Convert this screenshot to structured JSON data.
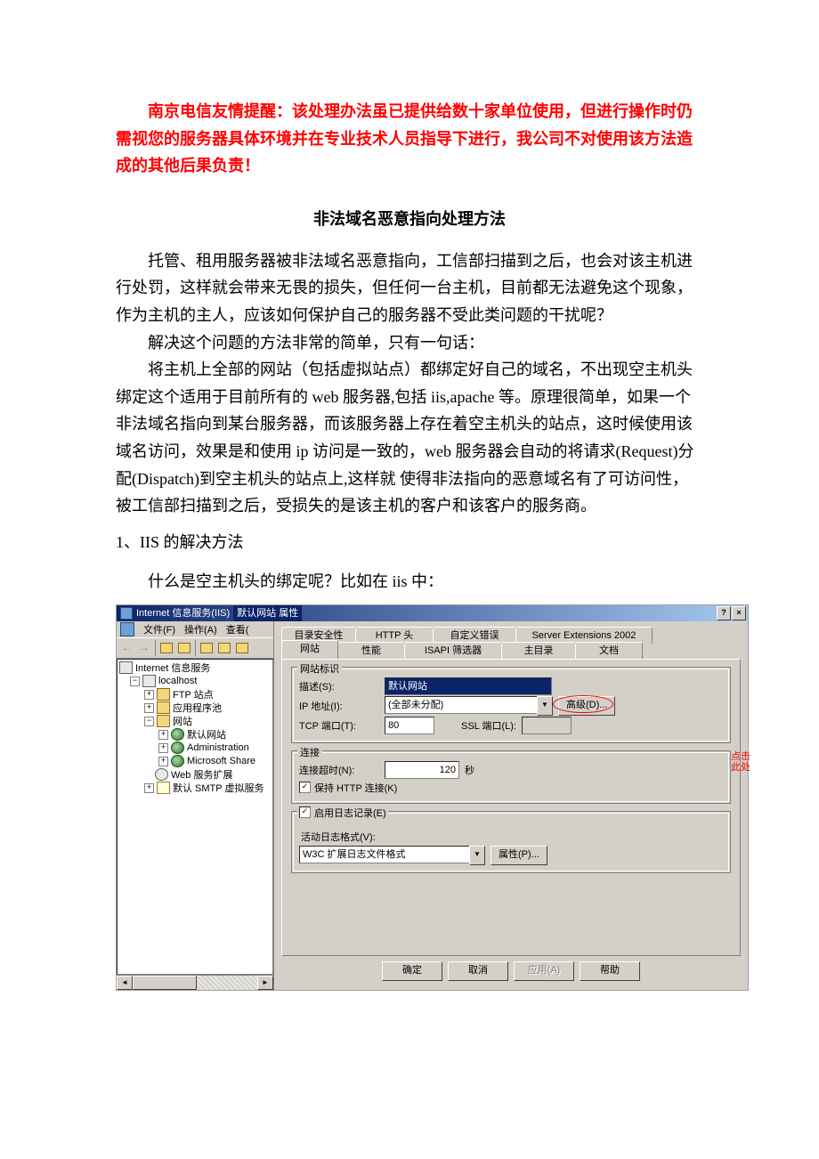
{
  "doc": {
    "warning": "南京电信友情提醒：该处理办法虽已提供给数十家单位使用，但进行操作时仍需视您的服务器具体环境并在专业技术人员指导下进行，我公司不对使用该方法造成的其他后果负责！",
    "title": "非法域名恶意指向处理方法",
    "p1": "托管、租用服务器被非法域名恶意指向，工信部扫描到之后，也会对该主机进行处罚，这样就会带来无畏的损失，但任何一台主机，目前都无法避免这个现象，作为主机的主人，应该如何保护自己的服务器不受此类问题的干扰呢？",
    "p2": "解决这个问题的方法非常的简单，只有一句话：",
    "p3": "将主机上全部的网站（包括虚拟站点）都绑定好自己的域名，不出现空主机头绑定这个适用于目前所有的 web 服务器,包括 iis,apache 等。原理很简单，如果一个非法域名指向到某台服务器，而该服务器上存在着空主机头的站点，这时候使用该域名访问，效果是和使用 ip 访问是一致的，web 服务器会自动的将请求(Request)分配(Dispatch)到空主机头的站点上,这样就 使得非法指向的恶意域名有了可访问性，被工信部扫描到之后，受损失的是该主机的客户和该客户的服务商。",
    "section1": "1、IIS 的解决方法",
    "sub1": "什么是空主机头的绑定呢？比如在 iis 中：",
    "callout": "点击\n此处"
  },
  "win": {
    "title_left": "Internet 信息服务(IIS)",
    "title_right": "默认网站 属性",
    "menu": {
      "file": "文件(F)",
      "action": "操作(A)",
      "view": "查看("
    },
    "tree": {
      "root": "Internet 信息服务",
      "host": "localhost",
      "ftp": "FTP 站点",
      "apppool": "应用程序池",
      "web": "网站",
      "defweb": "默认网站",
      "admin": "Administration",
      "mss": "Microsoft Share",
      "ext": "Web 服务扩展",
      "smtp": "默认 SMTP 虚拟服务"
    }
  },
  "dlg": {
    "tabs_top": {
      "t1": "目录安全性",
      "t2": "HTTP 头",
      "t3": "自定义错误",
      "t4": "Server Extensions 2002"
    },
    "tabs_bot": {
      "t1": "网站",
      "t2": "性能",
      "t3": "ISAPI 筛选器",
      "t4": "主目录",
      "t5": "文档"
    },
    "grp_site": "网站标识",
    "lbl_desc": "描述(S):",
    "val_desc": "默认网站",
    "lbl_ip": "IP 地址(I):",
    "val_ip": "(全部未分配)",
    "btn_adv": "高级(D)...",
    "lbl_port": "TCP 端口(T):",
    "val_port": "80",
    "lbl_ssl": "SSL 端口(L):",
    "grp_conn": "连接",
    "lbl_timeout": "连接超时(N):",
    "val_timeout": "120",
    "lbl_sec": "秒",
    "chk_keepalive": "保持 HTTP 连接(K)",
    "chk_log": "启用日志记录(E)",
    "lbl_logfmt": "活动日志格式(V):",
    "val_logfmt": "W3C 扩展日志文件格式",
    "btn_logprop": "属性(P)...",
    "btn_ok": "确定",
    "btn_cancel": "取消",
    "btn_apply": "应用(A)",
    "btn_help": "帮助"
  }
}
